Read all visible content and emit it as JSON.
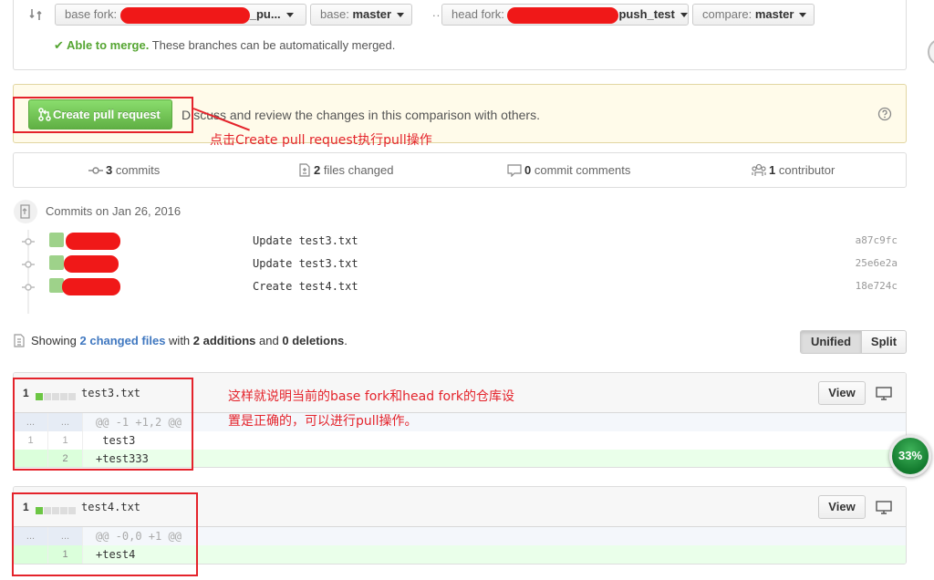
{
  "range": {
    "base_fork_label": "base fork:",
    "base_fork_value_suffix": "_pu...",
    "base_label": "base:",
    "base_value": "master",
    "dots": "...",
    "head_fork_label": "head fork:",
    "head_fork_value_suffix": "push_test",
    "compare_label": "compare:",
    "compare_value": "master",
    "merge_status": "✔ Able to merge.",
    "merge_detail": "These branches can be automatically merged."
  },
  "flash": {
    "create_button": "Create pull request",
    "text": "Discuss and review the changes in this comparison with others."
  },
  "annotations": {
    "create_hint": "点击Create pull request执行pull操作",
    "fork_hint_line1": "这样就说明当前的base fork和head fork的仓库设",
    "fork_hint_line2": "置是正确的，可以进行pull操作。"
  },
  "stats": {
    "commits_count": "3",
    "commits_label": "commits",
    "files_count": "2",
    "files_label": "files changed",
    "comments_count": "0",
    "comments_label": "commit comments",
    "contributors_count": "1",
    "contributors_label": "contributor"
  },
  "commits": {
    "date_heading": "Commits on Jan 26, 2016",
    "items": [
      {
        "message": "Update test3.txt",
        "sha": "a87c9fc"
      },
      {
        "message": "Update test3.txt",
        "sha": "25e6e2a"
      },
      {
        "message": "Create test4.txt",
        "sha": "18e724c"
      }
    ]
  },
  "summary": {
    "showing": "Showing",
    "changed_files": "2 changed files",
    "with": "with",
    "additions": "2 additions",
    "and": "and",
    "deletions": "0 deletions",
    "end": "."
  },
  "view_toggle": {
    "unified": "Unified",
    "split": "Split",
    "selected": "unified"
  },
  "files": [
    {
      "count": "1",
      "name": "test3.txt",
      "view": "View",
      "hunk_left": "...",
      "hunk_right": "...",
      "hunk": "@@ -1 +1,2 @@",
      "lines": [
        {
          "a": "1",
          "b": "1",
          "code": " test3"
        },
        {
          "a": "",
          "b": "2",
          "code": "+test333"
        }
      ]
    },
    {
      "count": "1",
      "name": "test4.txt",
      "view": "View",
      "hunk_left": "...",
      "hunk_right": "...",
      "hunk": "@@ -0,0 +1 @@",
      "lines": [
        {
          "a": "",
          "b": "1",
          "code": "+test4"
        }
      ]
    }
  ],
  "progress": {
    "value": "33%"
  },
  "colors": {
    "accent_green": "#60b044",
    "annotation_red": "#e4232b",
    "link_blue": "#4078c0"
  }
}
